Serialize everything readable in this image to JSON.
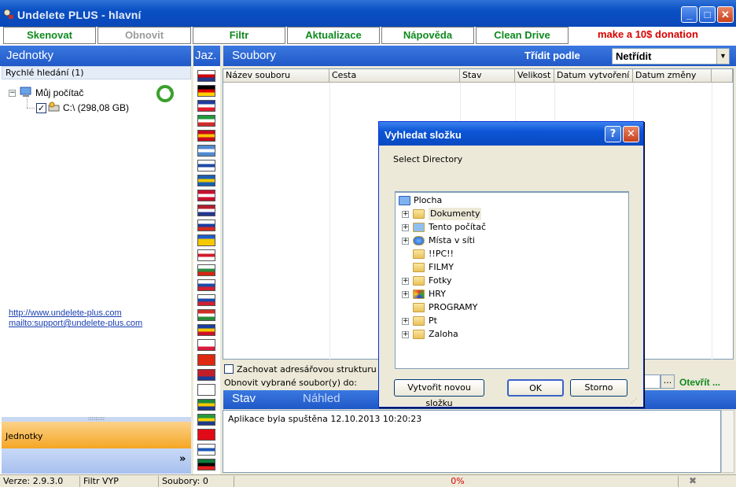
{
  "window": {
    "title": "Undelete PLUS -  hlavní"
  },
  "toolbar": {
    "items": [
      "Skenovat",
      "Obnovit",
      "Filtr",
      "Aktualizace",
      "Nápověda",
      "Clean Drive"
    ],
    "donation": "make a 10$ donation"
  },
  "left": {
    "header": "Jednotky",
    "quick_search": "Rychlé hledání (1)",
    "tree": {
      "root": "Můj počítač",
      "drive": "C:\\  (298,08 GB)"
    },
    "links": [
      "http://www.undelete-plus.com",
      "mailto:support@undelete-plus.com"
    ],
    "nav_active": "Jednotky"
  },
  "lang": {
    "header": "Jaz."
  },
  "files": {
    "header": "Soubory",
    "sort_label": "Třídit podle",
    "sort_value": "Netřídit",
    "columns": [
      "Název souboru",
      "Cesta",
      "Stav",
      "Velikost",
      "Datum vytvoření",
      "Datum změny"
    ],
    "keep_structure": "Zachovat adresářovou strukturu",
    "restore_to": "Obnovit vybrané soubor(y) do:",
    "browse": "...",
    "open": "Otevřít ..."
  },
  "stav": {
    "tabs": [
      "Stav",
      "Náhled"
    ],
    "log": "Aplikace byla spuštěna 12.10.2013 10:20:23"
  },
  "status": {
    "version": "Verze: 2.9.3.0",
    "filter": "Filtr VYP",
    "files": "Soubory: 0",
    "progress": "0%",
    "progress_value": 0
  },
  "dialog": {
    "title": "Vyhledat složku",
    "prompt": "Select Directory",
    "items": [
      "Plocha",
      "Dokumenty",
      "Tento počítač",
      "Místa v síti",
      "!!PC!!",
      "FILMY",
      "Fotky",
      "HRY",
      "PROGRAMY",
      "Pt",
      "Zaloha"
    ],
    "new_folder": "Vytvořit novou složku",
    "ok": "OK",
    "cancel": "Storno"
  },
  "colors": {
    "accent": "#1f58c8",
    "toolbar_text": "#0f8a1e",
    "donation": "#d80000",
    "progress_text": "#d80000"
  }
}
